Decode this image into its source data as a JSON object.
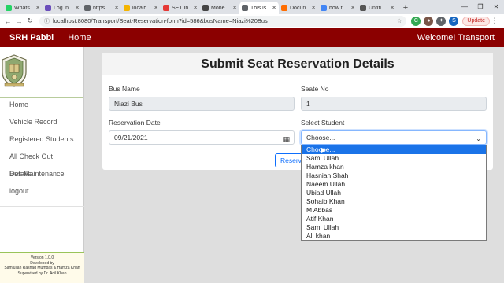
{
  "browser": {
    "tabs": [
      {
        "label": "Whats",
        "color": "#25d366"
      },
      {
        "label": "Log in",
        "color": "#6b4fbb"
      },
      {
        "label": "https",
        "color": "#5f6368"
      },
      {
        "label": "localh",
        "color": "#f4b400"
      },
      {
        "label": "SET In",
        "color": "#e53935"
      },
      {
        "label": "Mone",
        "color": "#444444"
      },
      {
        "label": "This is",
        "color": "#5f6368",
        "active": true
      },
      {
        "label": "Docun",
        "color": "#ff6d00"
      },
      {
        "label": "how t",
        "color": "#4285f4"
      },
      {
        "label": "Untitl",
        "color": "#555555"
      }
    ],
    "new_tab": "+",
    "url": "localhost:8080/Transport/Seat-Reservation-form?id=586&busName=Niazi%20Bus",
    "update_label": "Update"
  },
  "navbar": {
    "brand": "SRH Pabbi",
    "home": "Home",
    "welcome": "Welcome! Transport"
  },
  "sidebar": {
    "items": [
      "Home",
      "Vehicle Record",
      "Registered Students",
      "All Check Out Details",
      "Bus Maintenance",
      "logout"
    ],
    "footer": {
      "line1": "Version 1.0.0",
      "line2": "Developed by",
      "line3": "Samiullah Rashad Mumbas & Hamza Khan",
      "line4": "Supervised by Dr. Adil Khan"
    }
  },
  "form": {
    "title": "Submit Seat Reservation Details",
    "bus_name_label": "Bus Name",
    "bus_name_value": "Niazi Bus",
    "seat_no_label": "Seate No",
    "seat_no_value": "1",
    "date_label": "Reservation Date",
    "date_value": "09/21/2021",
    "student_label": "Select Student",
    "student_value": "Choose...",
    "reserve_label": "Reserve"
  },
  "dropdown": {
    "options": [
      "Choose...",
      "Sami Ullah",
      "Hamza khan",
      "Hasnian Shah",
      "Naeem Ullah",
      "Ubiad Ullah",
      "Sohaib Khan",
      "M Abbas",
      "Atif Khan",
      "Sami Ullah",
      "Ali khan"
    ]
  }
}
